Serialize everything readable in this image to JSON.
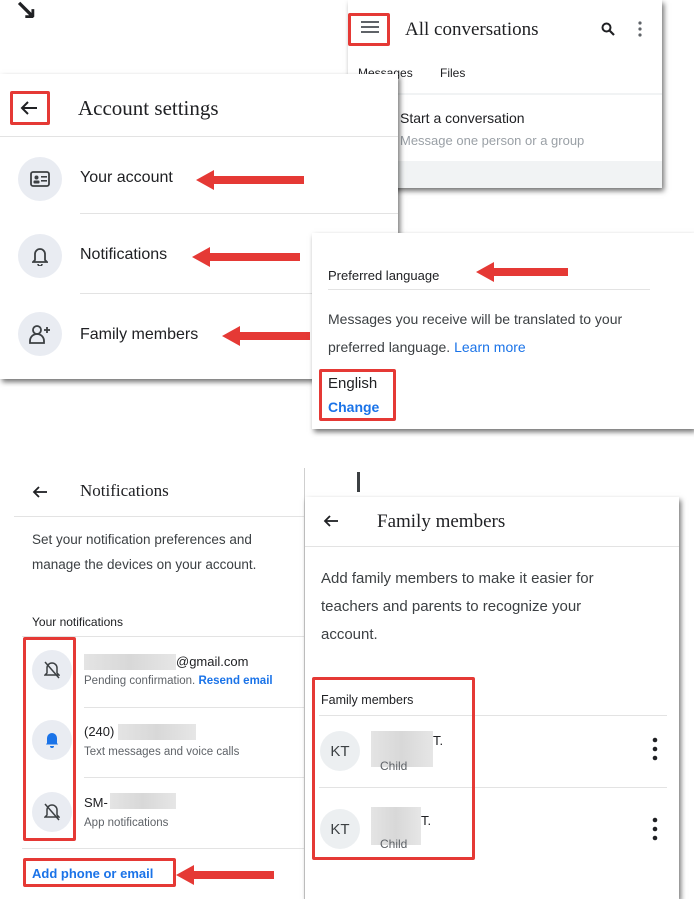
{
  "colors": {
    "accent": "#1a73e8",
    "annotation_red": "#e53935",
    "icon_circle": "#e9ecf2"
  },
  "conversations": {
    "title": "All conversations",
    "tabs": [
      {
        "label": "Messages"
      },
      {
        "label": "Files"
      }
    ],
    "start_title": "Start a conversation",
    "start_subtitle": "Message one person or a group"
  },
  "account_settings": {
    "title": "Account settings",
    "items": [
      {
        "label": "Your account",
        "icon": "id-card-icon"
      },
      {
        "label": "Notifications",
        "icon": "bell-icon"
      },
      {
        "label": "Family members",
        "icon": "person-add-icon"
      }
    ]
  },
  "language": {
    "title": "Preferred language",
    "description": "Messages you receive will be translated to your preferred language.",
    "learn_more": "Learn more",
    "current": "English",
    "change": "Change"
  },
  "notifications": {
    "title": "Notifications",
    "description_line1": "Set your notification preferences and",
    "description_line2": "manage the devices on your account.",
    "section": "Your notifications",
    "items": [
      {
        "value": "@gmail.com",
        "status": "Pending confirmation.",
        "action": "Resend email",
        "icon": "bell-off-icon"
      },
      {
        "value": "(240)",
        "status": "Text messages and voice calls",
        "icon": "bell-icon"
      },
      {
        "value": "SM-",
        "status": "App notifications",
        "icon": "bell-off-icon"
      }
    ],
    "add": "Add phone or email"
  },
  "family": {
    "title": "Family members",
    "description_line1": "Add family members to make it easier for",
    "description_line2": "teachers and parents to recognize your",
    "description_line3": "account.",
    "section": "Family members",
    "members": [
      {
        "initials": "KT",
        "name_suffix": "T.",
        "role": "Child"
      },
      {
        "initials": "KT",
        "name_suffix": "T.",
        "role": "Child"
      }
    ]
  }
}
